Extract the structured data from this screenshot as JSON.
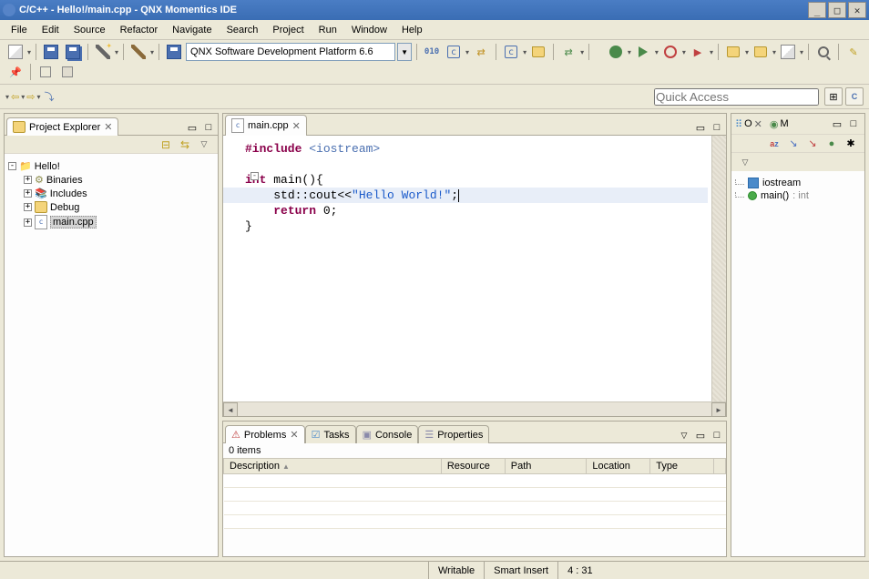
{
  "titlebar": {
    "title": "C/C++ - Hello!/main.cpp - QNX Momentics IDE"
  },
  "menu": {
    "file": "File",
    "edit": "Edit",
    "source": "Source",
    "refactor": "Refactor",
    "navigate": "Navigate",
    "search": "Search",
    "project": "Project",
    "run": "Run",
    "window": "Window",
    "help": "Help"
  },
  "toolbar": {
    "platform": "QNX Software Development Platform 6.6",
    "quick_access_placeholder": "Quick Access"
  },
  "project_explorer": {
    "title": "Project Explorer",
    "root": "Hello!",
    "items": [
      "Binaries",
      "Includes",
      "Debug",
      "main.cpp"
    ]
  },
  "editor": {
    "tab_label": "main.cpp",
    "code": {
      "l1_pp": "#include",
      "l1_inc": " <iostream>",
      "l3_kw": "int ",
      "l3_rest": "main(){",
      "l4_indent": "    ",
      "l4_call": "std::cout<<",
      "l4_str": "\"Hello World!\"",
      "l4_end": ";",
      "l5_indent": "    ",
      "l5_kw": "return",
      "l5_val": " 0;",
      "l6": "}"
    }
  },
  "outline": {
    "tab_o": "O",
    "tab_m": "M",
    "items": [
      {
        "icon": "square",
        "label": "iostream"
      },
      {
        "icon": "dot",
        "label": "main()",
        "type": " : int"
      }
    ]
  },
  "problems": {
    "tab": "Problems",
    "tasks": "Tasks",
    "console": "Console",
    "properties": "Properties",
    "count": "0 items",
    "cols": {
      "description": "Description",
      "resource": "Resource",
      "path": "Path",
      "location": "Location",
      "type": "Type"
    }
  },
  "status": {
    "writable": "Writable",
    "insert": "Smart Insert",
    "pos": "4 : 31"
  }
}
